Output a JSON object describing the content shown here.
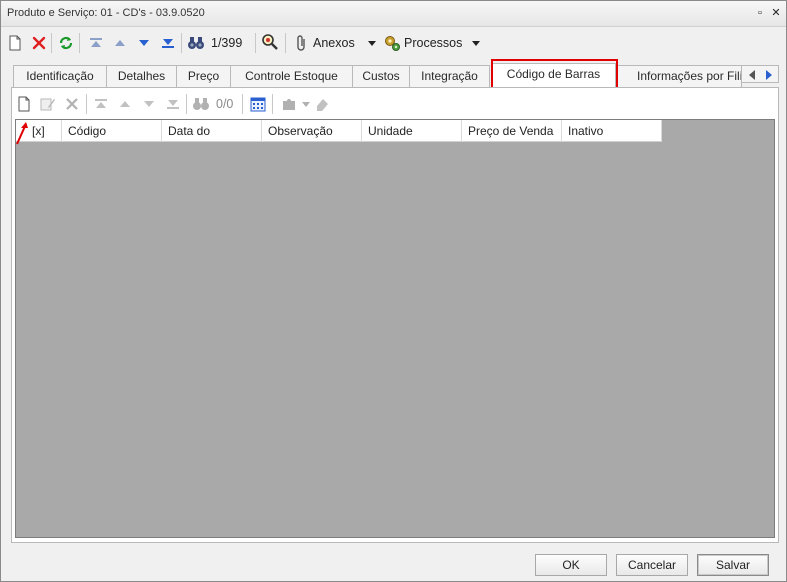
{
  "window": {
    "title": "Produto e Serviço: 01 - CD's - 03.9.0520",
    "minimize_glyph": "▫",
    "close_glyph": "✕"
  },
  "toolbar": {
    "record_counter": "1/399",
    "attachments_label": "Anexos",
    "processes_label": "Processos"
  },
  "tabs": [
    {
      "label": "Identificação"
    },
    {
      "label": "Detalhes"
    },
    {
      "label": "Preço"
    },
    {
      "label": "Controle Estoque"
    },
    {
      "label": "Custos"
    },
    {
      "label": "Integração"
    },
    {
      "label": "Código de Barras",
      "active": true
    },
    {
      "label": "Informações por Fili"
    }
  ],
  "inner_toolbar": {
    "record_counter": "0/0"
  },
  "grid": {
    "columns": [
      "[x]",
      "Código",
      "Data do",
      "Observação",
      "Unidade",
      "Preço de Venda",
      "Inativo"
    ]
  },
  "buttons": {
    "ok": "OK",
    "cancel": "Cancelar",
    "save": "Salvar"
  },
  "colors": {
    "highlight": "#e00000",
    "grid_background": "#a9a9a9"
  },
  "icons": [
    "new-icon",
    "delete-icon",
    "refresh-icon",
    "first-record-icon",
    "previous-record-icon",
    "next-record-icon",
    "last-record-icon",
    "binoculars-icon",
    "search-magnifier-icon",
    "paperclip-icon",
    "gears-icon",
    "edit-icon",
    "calendar-icon",
    "puzzle-icon",
    "dropdown-arrow-icon",
    "tab-scroll-left-icon",
    "tab-scroll-right-icon"
  ]
}
